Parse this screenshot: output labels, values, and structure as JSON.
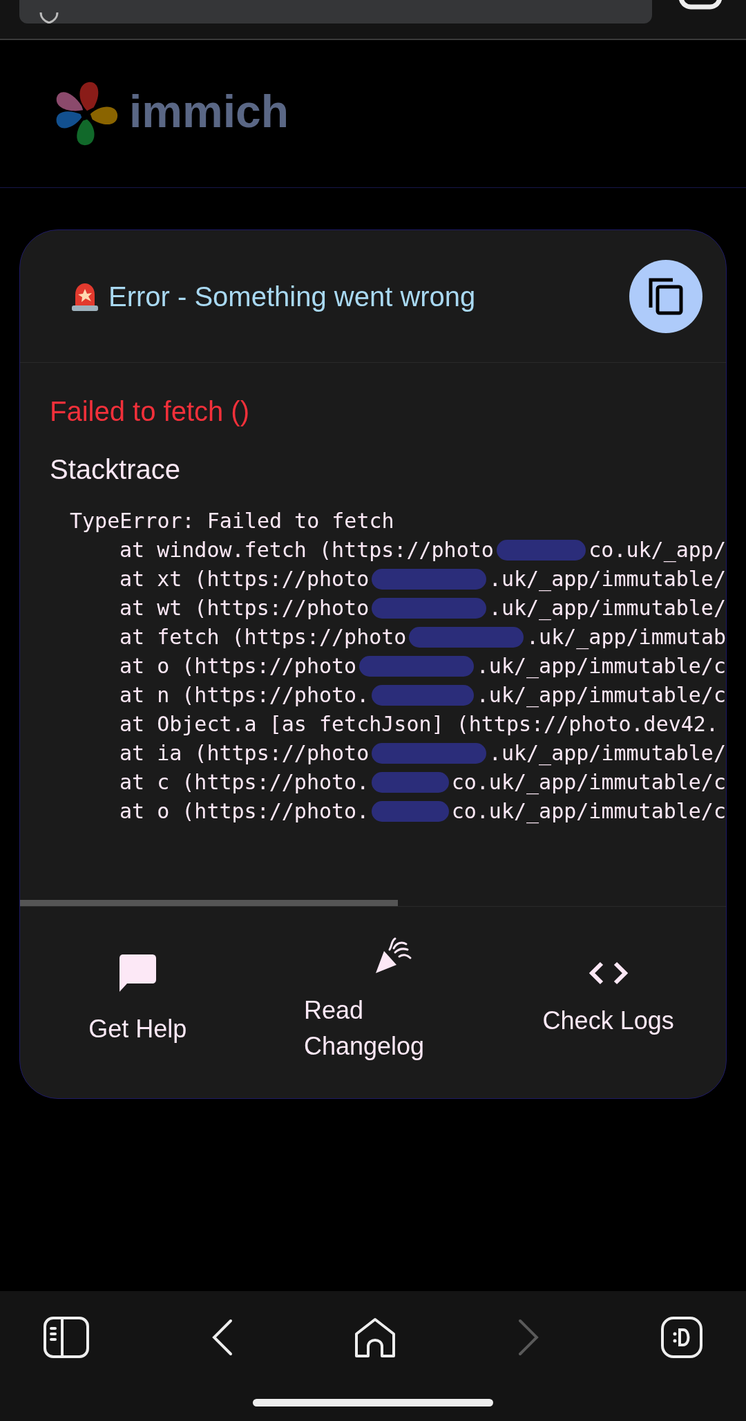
{
  "app": {
    "logo_text": "immich"
  },
  "error_card": {
    "title": "Error - Something went wrong",
    "message": "Failed to fetch ()",
    "stacktrace_heading": "Stacktrace",
    "stacktrace_lines": [
      {
        "kind": "message",
        "text": "TypeError: Failed to fetch"
      },
      {
        "kind": "frame",
        "text": "at window.fetch (https://photo",
        "text_after": "co.uk/_app/"
      },
      {
        "kind": "frame",
        "text": "at xt (https://photo",
        "text_after": ".uk/_app/immutable/"
      },
      {
        "kind": "frame",
        "text": "at wt (https://photo",
        "text_after": ".uk/_app/immutable/"
      },
      {
        "kind": "frame",
        "text": "at fetch (https://photo",
        "text_after": ".uk/_app/immutab"
      },
      {
        "kind": "frame",
        "text": "at o (https://photo",
        "text_after": ".uk/_app/immutable/c"
      },
      {
        "kind": "frame",
        "text": "at n (https://photo.",
        "text_after": ".uk/_app/immutable/c"
      },
      {
        "kind": "frame",
        "text": "at Object.a [as fetchJson] (https://photo.dev42."
      },
      {
        "kind": "frame",
        "text": "at ia (https://photo",
        "text_after": ".uk/_app/immutable/"
      },
      {
        "kind": "frame",
        "text": "at c (https://photo.",
        "text_after": "co.uk/_app/immutable/c"
      },
      {
        "kind": "frame",
        "text": "at o (https://photo.",
        "text_after": "co.uk/_app/immutable/c"
      }
    ],
    "actions": [
      {
        "kind": "help",
        "label": "Get Help"
      },
      {
        "kind": "changelog",
        "label": "Read Changelog"
      },
      {
        "kind": "logs",
        "label": "Check Logs"
      }
    ]
  },
  "browser_nav": [
    {
      "kind": "sidebar",
      "disabled": false
    },
    {
      "kind": "back",
      "disabled": false
    },
    {
      "kind": "home",
      "disabled": false
    },
    {
      "kind": "forward",
      "disabled": true
    },
    {
      "kind": "tabs",
      "disabled": false
    }
  ]
}
